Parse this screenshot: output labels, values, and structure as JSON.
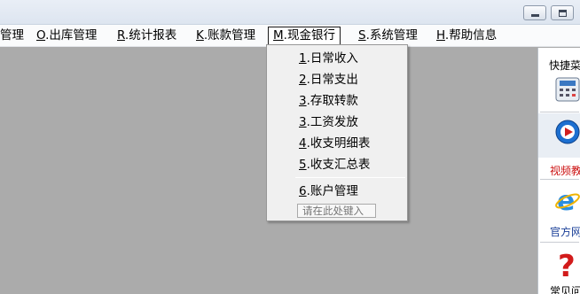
{
  "window_controls": {
    "minimize_icon": "minimize-icon",
    "maximize_icon": "maximize-icon"
  },
  "menubar": {
    "items": [
      {
        "label": "管理",
        "shortcut": "",
        "rest": "管理"
      },
      {
        "shortcut": "O",
        "rest": ".出库管理"
      },
      {
        "shortcut": "R",
        "rest": ".统计报表"
      },
      {
        "shortcut": "K",
        "rest": ".账款管理"
      },
      {
        "shortcut": "M",
        "rest": ".现金银行"
      },
      {
        "shortcut": "S",
        "rest": ".系统管理"
      },
      {
        "shortcut": "H",
        "rest": ".帮助信息"
      }
    ]
  },
  "dropdown": {
    "items": [
      {
        "shortcut": "1",
        "rest": ".日常收入"
      },
      {
        "shortcut": "2",
        "rest": ".日常支出"
      },
      {
        "shortcut": "3",
        "rest": ".存取转款"
      },
      {
        "shortcut": "3",
        "rest": ".工资发放"
      },
      {
        "shortcut": "4",
        "rest": ".收支明细表"
      },
      {
        "shortcut": "5",
        "rest": ".收支汇总表"
      },
      {
        "shortcut": "6",
        "rest": ".账户管理"
      }
    ],
    "input_placeholder": "请在此处键入"
  },
  "quickpanel": {
    "title": "快捷菜",
    "items": [
      {
        "label": "",
        "icon": "calculator-icon"
      },
      {
        "label": "视频教",
        "icon": "video-player-icon"
      },
      {
        "label": "官方网",
        "icon": "internet-explorer-icon"
      },
      {
        "label": "常见问",
        "icon": "help-question-icon"
      }
    ]
  },
  "colors": {
    "client_background": "#ababab",
    "menubar_background": "#fafbfc",
    "dropdown_background": "#f0f0f0",
    "video_label": "#cc1111",
    "link_label": "#1a3f98"
  }
}
